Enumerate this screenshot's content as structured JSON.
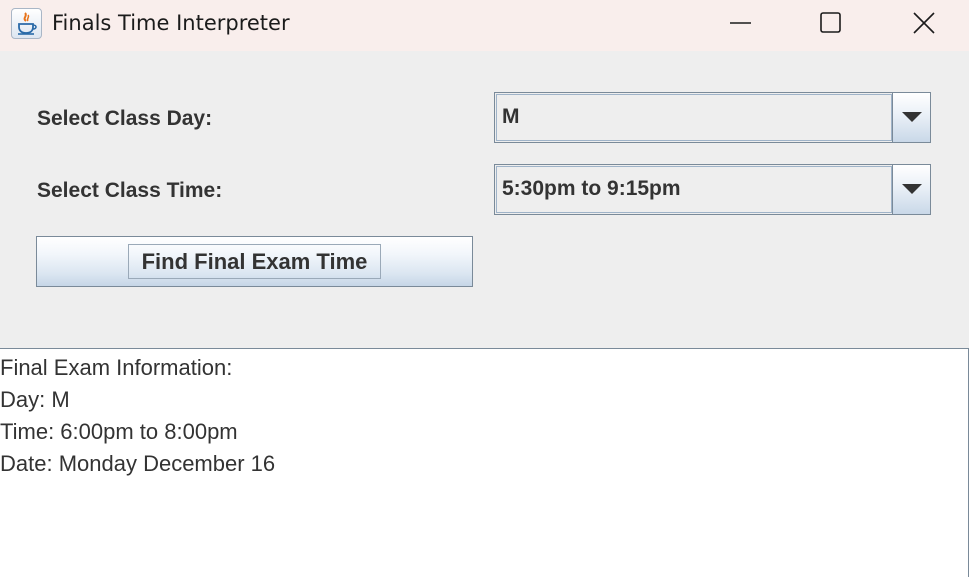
{
  "window": {
    "title": "Finals Time Interpreter",
    "icon": "java-coffee-icon",
    "controls": [
      "minimize-icon",
      "maximize-icon",
      "close-icon"
    ]
  },
  "form": {
    "day_label": "Select Class Day:",
    "day_value": "M",
    "time_label": "Select Class Time:",
    "time_value": "5:30pm to 9:15pm",
    "find_button_label": "Find Final Exam Time"
  },
  "output": {
    "lines": [
      "Final Exam Information:",
      "Day: M",
      "Time: 6:00pm to 8:00pm",
      "Date: Monday December 16"
    ]
  },
  "colors": {
    "titlebar_bg": "#f9eeec",
    "panel_bg": "#eeeeee",
    "text": "#333333",
    "border": "#7a8a99"
  }
}
